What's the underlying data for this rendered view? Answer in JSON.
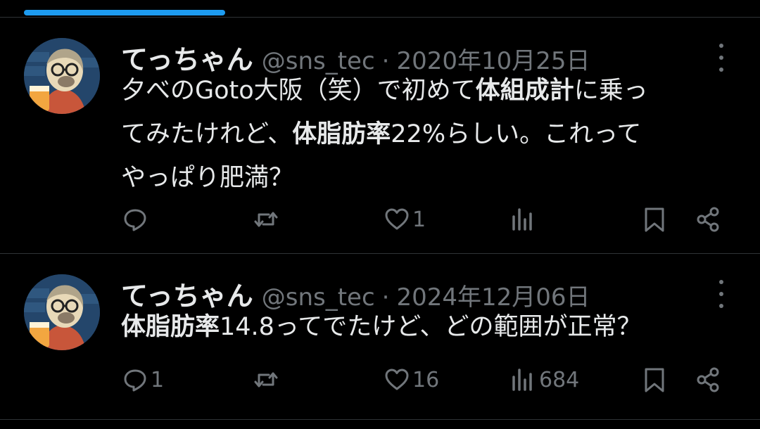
{
  "tweets": [
    {
      "name": "てっちゃん",
      "handle": "@sns_tec",
      "dot": "·",
      "date": "2020年10月25日",
      "text_parts": [
        {
          "text": "夕べのGoto大阪（笑）で初めて",
          "bold": false
        },
        {
          "text": "体組成計",
          "bold": true
        },
        {
          "text": "に乗っ",
          "bold": false
        },
        {
          "text": "てみたけれど、",
          "bold": false
        },
        {
          "text": "体脂肪率",
          "bold": true
        },
        {
          "text": "22%らしい。これって",
          "bold": false
        },
        {
          "text": "やっぱり肥満？",
          "bold": false
        }
      ],
      "replies": "",
      "retweets": "",
      "likes": "1",
      "views": ""
    },
    {
      "name": "てっちゃん",
      "handle": "@sns_tec",
      "dot": "·",
      "date": "2024年12月06日",
      "text_parts": [
        {
          "text": "体脂肪率",
          "bold": true
        },
        {
          "text": "14.8ってでたけど、どの範囲が正常？",
          "bold": false
        }
      ],
      "replies": "1",
      "retweets": "",
      "likes": "16",
      "views": "684"
    }
  ],
  "icons": {
    "reply": "speech-bubble-icon",
    "retweet": "retweet-arrows-icon",
    "like": "heart-icon",
    "views": "bar-chart-icon",
    "bookmark": "bookmark-icon",
    "share": "share-nodes-icon",
    "more": "vertical-dots-icon"
  },
  "colors": {
    "background": "#000000",
    "text": "#e7e9ea",
    "muted": "#71767b",
    "divider": "#2f3336",
    "accent": "#1d9bf0"
  }
}
